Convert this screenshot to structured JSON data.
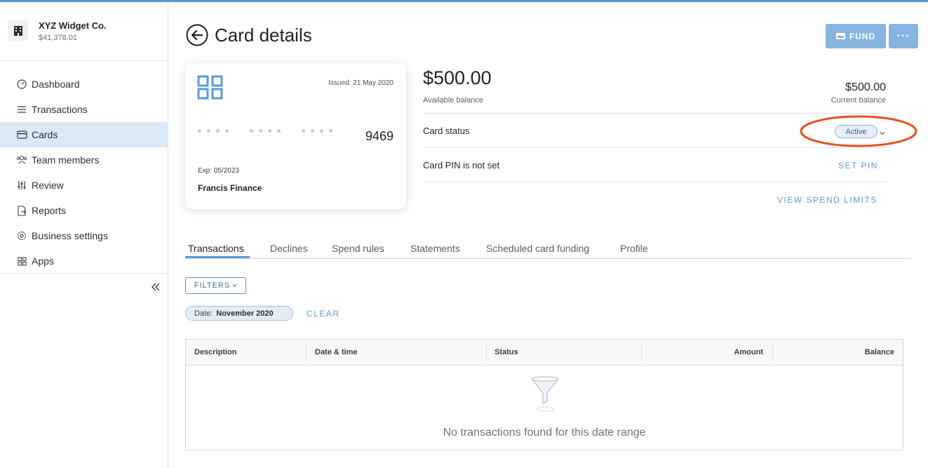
{
  "company": {
    "name": "XYZ Widget Co.",
    "balance": "$41,378.01",
    "logo_icon": "building-icon"
  },
  "sidebar": {
    "items": [
      {
        "label": "Dashboard",
        "icon": "gauge-icon"
      },
      {
        "label": "Transactions",
        "icon": "list-icon"
      },
      {
        "label": "Cards",
        "icon": "card-icon",
        "active": true
      },
      {
        "label": "Team members",
        "icon": "team-icon"
      },
      {
        "label": "Review",
        "icon": "sliders-icon"
      },
      {
        "label": "Reports",
        "icon": "report-icon"
      },
      {
        "label": "Business settings",
        "icon": "gear-icon"
      },
      {
        "label": "Apps",
        "icon": "grid-icon"
      }
    ],
    "collapse_icon": "double-chevron-left-icon"
  },
  "header": {
    "title": "Card details",
    "fund_label": "FUND",
    "more_label": "···"
  },
  "card": {
    "issued": "Issued: 21 May 2020",
    "last4": "9469",
    "expiry": "Exp: 05/2023",
    "holder": "Francis Finance"
  },
  "balance": {
    "available_amount": "$500.00",
    "available_label": "Available balance",
    "current_amount": "$500.00",
    "current_label": "Current balance"
  },
  "status": {
    "label": "Card status",
    "value": "Active"
  },
  "pin": {
    "label": "Card PIN is not set",
    "action": "SET PIN"
  },
  "spend_limits_link": "VIEW SPEND LIMITS",
  "tabs": [
    "Transactions",
    "Declines",
    "Spend rules",
    "Statements",
    "Scheduled card funding",
    "Profile"
  ],
  "filters": {
    "button_label": "FILTERS",
    "chip_key": "Date:",
    "chip_value": "November 2020",
    "clear_label": "CLEAR"
  },
  "table": {
    "columns": [
      "Description",
      "Date & time",
      "Status",
      "Amount",
      "Balance"
    ],
    "empty_message": "No transactions found for this date range"
  },
  "colors": {
    "accent": "#5b9ad6",
    "button": "#86b5e0",
    "highlight": "#e2501f",
    "active_nav": "#dbe8f5"
  }
}
